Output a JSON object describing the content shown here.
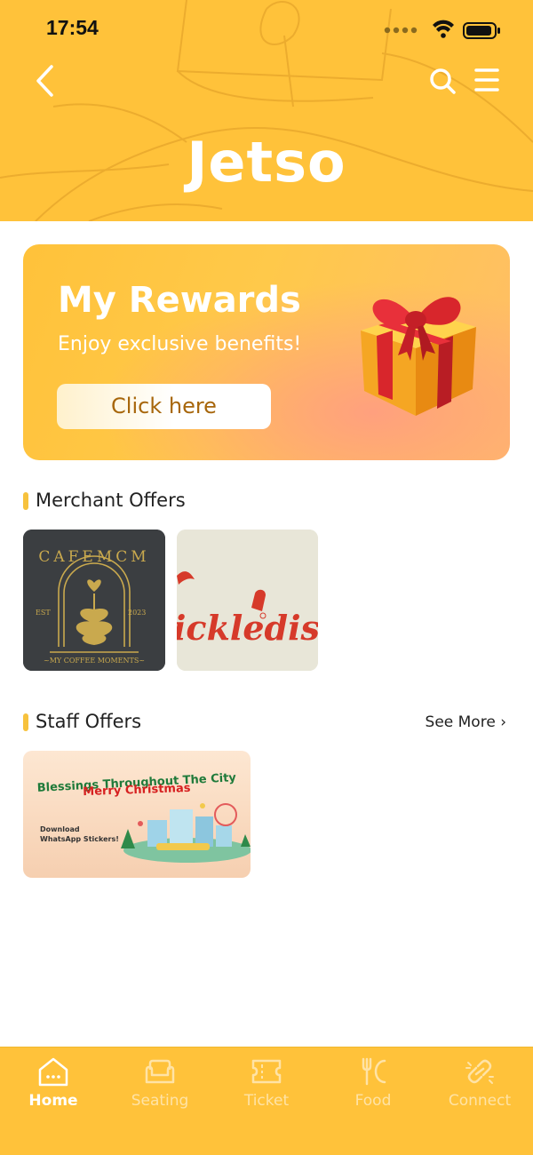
{
  "status_bar": {
    "time": "17:54"
  },
  "header": {
    "title": "Jetso"
  },
  "rewards": {
    "title": "My Rewards",
    "subtitle": "Enjoy exclusive benefits!",
    "button_label": "Click here"
  },
  "merchant_offers": {
    "title": "Merchant Offers",
    "items": [
      {
        "name": "CAFEMCM",
        "est": "EST",
        "year": "2023",
        "tagline": "~MY COFFEE MOMENTS~"
      },
      {
        "name": "ickledise.h"
      }
    ]
  },
  "staff_offers": {
    "title": "Staff Offers",
    "see_more": "See More ›",
    "items": [
      {
        "line1": "Blessings Throughout The City",
        "line2": "Merry Christmas",
        "line3": "Download",
        "line4": "WhatsApp Stickers!"
      }
    ]
  },
  "tabbar": {
    "items": [
      {
        "label": "Home",
        "icon": "home-icon",
        "active": true
      },
      {
        "label": "Seating",
        "icon": "sofa-icon",
        "active": false
      },
      {
        "label": "Ticket",
        "icon": "ticket-icon",
        "active": false
      },
      {
        "label": "Food",
        "icon": "utensils-icon",
        "active": false
      },
      {
        "label": "Connect",
        "icon": "link-icon",
        "active": false
      }
    ]
  },
  "colors": {
    "brand": "#ffc23a",
    "accent_bar": "#f7c23d",
    "button_text": "#a7660b"
  }
}
